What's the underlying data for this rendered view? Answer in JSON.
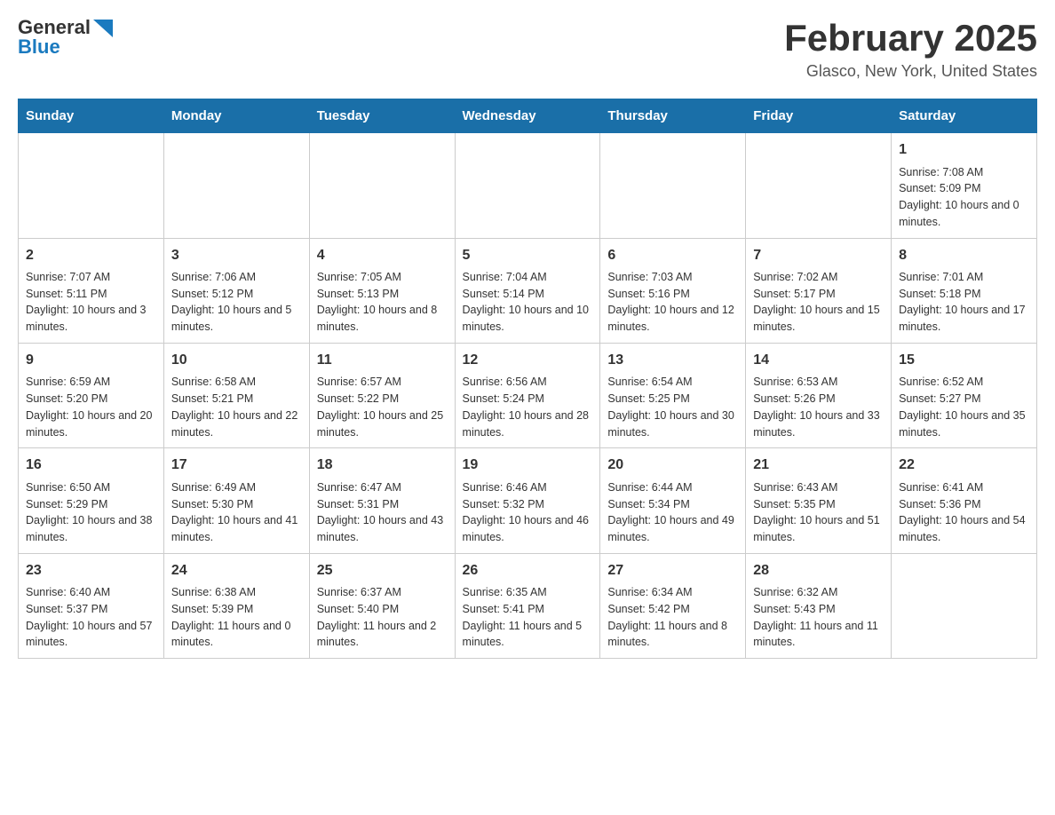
{
  "logo": {
    "line1": "General",
    "line2": "Blue"
  },
  "title": "February 2025",
  "subtitle": "Glasco, New York, United States",
  "days_of_week": [
    "Sunday",
    "Monday",
    "Tuesday",
    "Wednesday",
    "Thursday",
    "Friday",
    "Saturday"
  ],
  "weeks": [
    [
      {
        "day": "",
        "info": ""
      },
      {
        "day": "",
        "info": ""
      },
      {
        "day": "",
        "info": ""
      },
      {
        "day": "",
        "info": ""
      },
      {
        "day": "",
        "info": ""
      },
      {
        "day": "",
        "info": ""
      },
      {
        "day": "1",
        "info": "Sunrise: 7:08 AM\nSunset: 5:09 PM\nDaylight: 10 hours and 0 minutes."
      }
    ],
    [
      {
        "day": "2",
        "info": "Sunrise: 7:07 AM\nSunset: 5:11 PM\nDaylight: 10 hours and 3 minutes."
      },
      {
        "day": "3",
        "info": "Sunrise: 7:06 AM\nSunset: 5:12 PM\nDaylight: 10 hours and 5 minutes."
      },
      {
        "day": "4",
        "info": "Sunrise: 7:05 AM\nSunset: 5:13 PM\nDaylight: 10 hours and 8 minutes."
      },
      {
        "day": "5",
        "info": "Sunrise: 7:04 AM\nSunset: 5:14 PM\nDaylight: 10 hours and 10 minutes."
      },
      {
        "day": "6",
        "info": "Sunrise: 7:03 AM\nSunset: 5:16 PM\nDaylight: 10 hours and 12 minutes."
      },
      {
        "day": "7",
        "info": "Sunrise: 7:02 AM\nSunset: 5:17 PM\nDaylight: 10 hours and 15 minutes."
      },
      {
        "day": "8",
        "info": "Sunrise: 7:01 AM\nSunset: 5:18 PM\nDaylight: 10 hours and 17 minutes."
      }
    ],
    [
      {
        "day": "9",
        "info": "Sunrise: 6:59 AM\nSunset: 5:20 PM\nDaylight: 10 hours and 20 minutes."
      },
      {
        "day": "10",
        "info": "Sunrise: 6:58 AM\nSunset: 5:21 PM\nDaylight: 10 hours and 22 minutes."
      },
      {
        "day": "11",
        "info": "Sunrise: 6:57 AM\nSunset: 5:22 PM\nDaylight: 10 hours and 25 minutes."
      },
      {
        "day": "12",
        "info": "Sunrise: 6:56 AM\nSunset: 5:24 PM\nDaylight: 10 hours and 28 minutes."
      },
      {
        "day": "13",
        "info": "Sunrise: 6:54 AM\nSunset: 5:25 PM\nDaylight: 10 hours and 30 minutes."
      },
      {
        "day": "14",
        "info": "Sunrise: 6:53 AM\nSunset: 5:26 PM\nDaylight: 10 hours and 33 minutes."
      },
      {
        "day": "15",
        "info": "Sunrise: 6:52 AM\nSunset: 5:27 PM\nDaylight: 10 hours and 35 minutes."
      }
    ],
    [
      {
        "day": "16",
        "info": "Sunrise: 6:50 AM\nSunset: 5:29 PM\nDaylight: 10 hours and 38 minutes."
      },
      {
        "day": "17",
        "info": "Sunrise: 6:49 AM\nSunset: 5:30 PM\nDaylight: 10 hours and 41 minutes."
      },
      {
        "day": "18",
        "info": "Sunrise: 6:47 AM\nSunset: 5:31 PM\nDaylight: 10 hours and 43 minutes."
      },
      {
        "day": "19",
        "info": "Sunrise: 6:46 AM\nSunset: 5:32 PM\nDaylight: 10 hours and 46 minutes."
      },
      {
        "day": "20",
        "info": "Sunrise: 6:44 AM\nSunset: 5:34 PM\nDaylight: 10 hours and 49 minutes."
      },
      {
        "day": "21",
        "info": "Sunrise: 6:43 AM\nSunset: 5:35 PM\nDaylight: 10 hours and 51 minutes."
      },
      {
        "day": "22",
        "info": "Sunrise: 6:41 AM\nSunset: 5:36 PM\nDaylight: 10 hours and 54 minutes."
      }
    ],
    [
      {
        "day": "23",
        "info": "Sunrise: 6:40 AM\nSunset: 5:37 PM\nDaylight: 10 hours and 57 minutes."
      },
      {
        "day": "24",
        "info": "Sunrise: 6:38 AM\nSunset: 5:39 PM\nDaylight: 11 hours and 0 minutes."
      },
      {
        "day": "25",
        "info": "Sunrise: 6:37 AM\nSunset: 5:40 PM\nDaylight: 11 hours and 2 minutes."
      },
      {
        "day": "26",
        "info": "Sunrise: 6:35 AM\nSunset: 5:41 PM\nDaylight: 11 hours and 5 minutes."
      },
      {
        "day": "27",
        "info": "Sunrise: 6:34 AM\nSunset: 5:42 PM\nDaylight: 11 hours and 8 minutes."
      },
      {
        "day": "28",
        "info": "Sunrise: 6:32 AM\nSunset: 5:43 PM\nDaylight: 11 hours and 11 minutes."
      },
      {
        "day": "",
        "info": ""
      }
    ]
  ]
}
